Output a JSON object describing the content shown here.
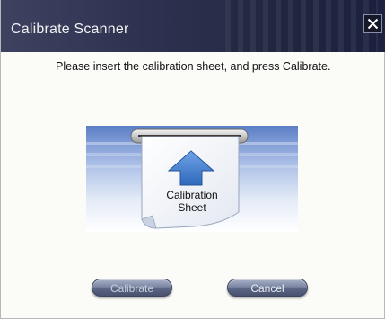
{
  "window": {
    "title": "Calibrate Scanner",
    "close_icon": "close-icon"
  },
  "message": "Please insert the calibration sheet, and press Calibrate.",
  "illustration": {
    "sheet_label_line1": "Calibration",
    "sheet_label_line2": "Sheet",
    "arrow_icon": "up-arrow-icon"
  },
  "buttons": {
    "calibrate_label": "Calibrate",
    "calibrate_state": "disabled",
    "cancel_label": "Cancel"
  },
  "colors": {
    "titlebar": "#2d3350",
    "arrow": "#3f7fd0",
    "button": "#6b7593"
  }
}
